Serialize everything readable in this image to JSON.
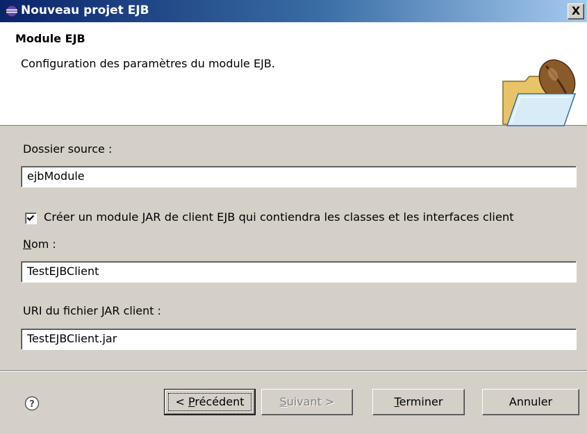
{
  "window": {
    "title": "Nouveau projet EJB",
    "close_label": "X"
  },
  "banner": {
    "title": "Module EJB",
    "description": "Configuration des paramètres du module EJB."
  },
  "form": {
    "source_folder_label": "Dossier source :",
    "source_folder_value": "ejbModule",
    "create_client_checked": true,
    "create_client_label": "Créer un module JAR de client EJB qui contiendra les classes et les interfaces client",
    "name_label_mnemonic": "N",
    "name_label_rest": "om :",
    "name_value": "TestEJBClient",
    "uri_label": "URI du fichier JAR client :",
    "uri_value": "TestEJBClient.jar"
  },
  "buttons": {
    "back_prefix": "< ",
    "back_mnemonic": "P",
    "back_rest": "récédent",
    "next_mnemonic": "S",
    "next_rest": "uivant >",
    "finish_mnemonic": "T",
    "finish_rest": "erminer",
    "cancel_label": "Annuler"
  },
  "icons": {
    "title": "eclipse-icon",
    "banner": "ejb-folder-icon",
    "help": "help-icon"
  },
  "colors": {
    "titlebar_start": "#0a246a",
    "titlebar_end": "#a6caf0",
    "dialog_bg": "#d4d0c8"
  }
}
